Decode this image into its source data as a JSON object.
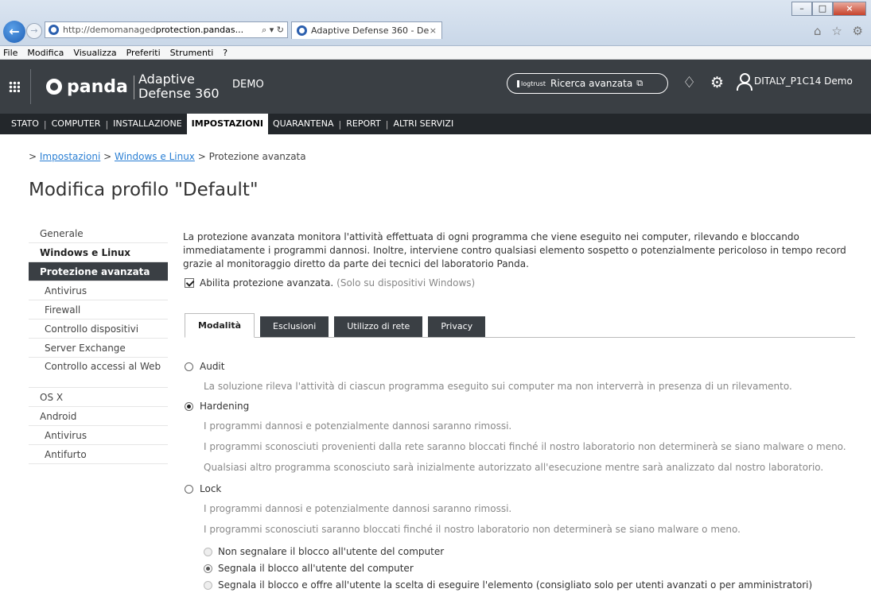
{
  "browser": {
    "url_prefix": "http://demomanaged",
    "url_bold": "protection.pandas...",
    "url_tools": "⌕ ▾ ↻",
    "tab_title": "Adaptive Defense 360 - De...",
    "tab_close": "×",
    "back_icon": "←",
    "forward_icon": "→",
    "right_icons": "⌂ ☆ ⚙",
    "min": "–",
    "max": "□",
    "close": "×",
    "menu": [
      "File",
      "Modifica",
      "Visualizza",
      "Preferiti",
      "Strumenti",
      "?"
    ]
  },
  "header": {
    "brand": "panda",
    "product_line1": "Adaptive",
    "product_line2": "Defense 360",
    "demo": "DEMO",
    "search_brand": "logtrust",
    "search_label": "Ricerca avanzata",
    "search_ext_icon": "⧉",
    "bell_icon": "♢",
    "gear_icon": "⚙",
    "user": "DITALY_P1C14 Demo"
  },
  "mainnav": {
    "items": [
      "STATO",
      "COMPUTER",
      "INSTALLAZIONE",
      "IMPOSTAZIONI",
      "QUARANTENA",
      "REPORT",
      "ALTRI SERVIZI"
    ],
    "separator": "|"
  },
  "breadcrumb": {
    "prefix": "> ",
    "link1": "Impostazioni",
    "sep": " > ",
    "link2": "Windows e Linux",
    "current": " > Protezione avanzata"
  },
  "page_title": "Modifica profilo \"Default\"",
  "sidebar": {
    "items": [
      "Generale",
      "Windows e Linux",
      "Protezione avanzata",
      "Antivirus",
      "Firewall",
      "Controllo dispositivi",
      "Server Exchange",
      "Controllo accessi al Web",
      "OS X",
      "Android",
      "Antivirus",
      "Antifurto"
    ]
  },
  "content": {
    "description": "La protezione avanzata monitora l'attività effettuata di ogni programma che viene eseguito nei computer, rilevando e bloccando immediatamente i programmi dannosi. Inoltre, interviene contro qualsiasi elemento sospetto o potenzialmente pericoloso in tempo record grazie al monitoraggio diretto da parte dei tecnici del laboratorio Panda.",
    "enable_label": "Abilita protezione avanzata.",
    "enable_note": "(Solo su dispositivi Windows)",
    "tabs": [
      "Modalità",
      "Esclusioni",
      "Utilizzo di rete",
      "Privacy"
    ],
    "audit": {
      "label": "Audit",
      "lines": [
        "La soluzione rileva l'attività di ciascun programma eseguito sui computer ma non interverrà in presenza di un rilevamento."
      ]
    },
    "hardening": {
      "label": "Hardening",
      "lines": [
        "I programmi dannosi e potenzialmente dannosi saranno rimossi.",
        "I programmi sconosciuti provenienti dalla rete saranno bloccati finché il nostro laboratorio non determinerà se siano malware o meno.",
        "Qualsiasi altro programma sconosciuto sarà inizialmente autorizzato all'esecuzione mentre sarà analizzato dal nostro laboratorio."
      ]
    },
    "lock": {
      "label": "Lock",
      "lines": [
        "I programmi dannosi e potenzialmente dannosi saranno rimossi.",
        "I programmi sconosciuti saranno bloccati finché il nostro laboratorio non determinerà se siano malware o meno."
      ],
      "sub_options": [
        "Non segnalare il blocco all'utente del computer",
        "Segnala il blocco all'utente del computer",
        "Segnala il blocco e offre all'utente la scelta di eseguire l'elemento (consigliato solo per utenti avanzati o per amministratori)"
      ]
    }
  }
}
